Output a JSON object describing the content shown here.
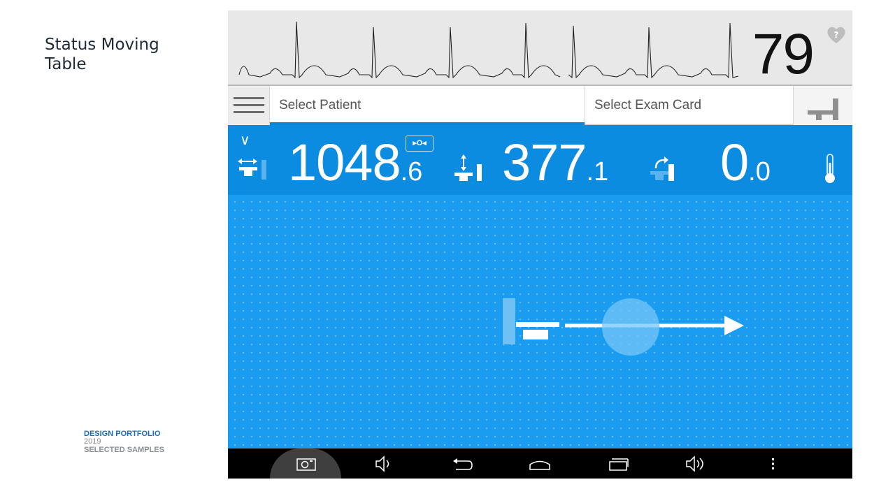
{
  "slide": {
    "title": "Status Moving\nTable",
    "footer_line1": "DESIGN PORTFOLIO",
    "footer_line2": "2019",
    "footer_line3": "SELECTED SAMPLES"
  },
  "monitor": {
    "heart_rate": "79",
    "heart_icon": "heart-question-icon"
  },
  "selectors": {
    "menu_icon": "hamburger-menu-icon",
    "patient_placeholder": "Select Patient",
    "exam_placeholder": "Select Exam Card",
    "table_icon": "table-position-icon"
  },
  "readout": {
    "collapse_icon": "chevron-down-icon",
    "zero_badge": "▸O◂",
    "horizontal": {
      "icon": "table-horizontal-icon",
      "main": "1048",
      "decimal": ".6"
    },
    "vertical": {
      "icon": "table-vertical-icon",
      "main": "377",
      "decimal": ".1"
    },
    "rotation": {
      "icon": "table-tilt-icon",
      "main": "0",
      "decimal": ".0"
    },
    "temperature_icon": "thermometer-icon"
  },
  "navbar": {
    "icons": [
      "camera-icon",
      "volume-down-icon",
      "back-icon",
      "home-icon",
      "recent-apps-icon",
      "volume-up-icon",
      "more-vert-icon"
    ]
  },
  "colors": {
    "accent": "#0b8ce0",
    "canvas": "#1a9cf0",
    "ecg_bg": "#e8e8e8",
    "footer_brand": "#1a6db5"
  }
}
